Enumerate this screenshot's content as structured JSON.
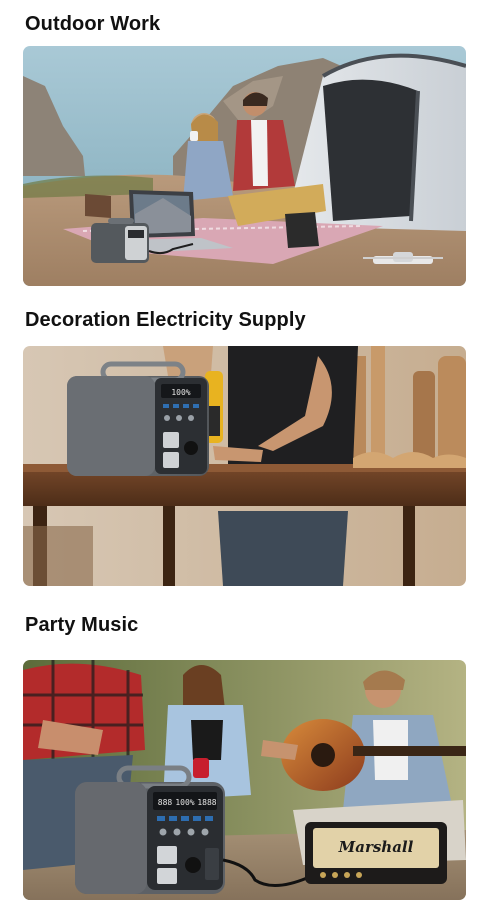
{
  "sections": [
    {
      "title": "Outdoor Work",
      "image_alt": "Couple on a picnic blanket by the sea next to a tent, a laptop powered by a portable power station, a drone on the ground"
    },
    {
      "title": "Decoration Electricity Supply",
      "image_alt": "Portable power station on a wooden workbench, a power drill on the bench and a person working at the table"
    },
    {
      "title": "Party Music",
      "image_alt": "Friends playing guitar outdoors, portable power station powering a Marshall speaker"
    }
  ],
  "device": {
    "display_left": "888",
    "display_mid": "100%",
    "display_right": "1888"
  },
  "speaker_brand": "Marshall"
}
